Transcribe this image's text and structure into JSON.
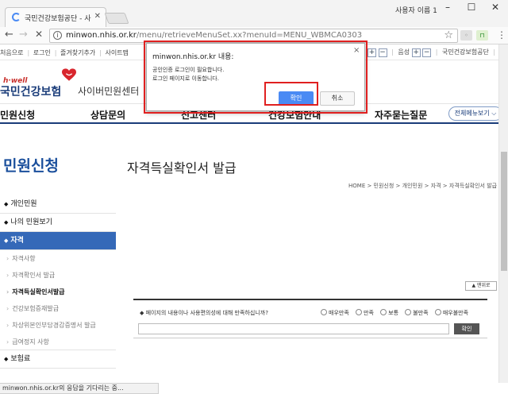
{
  "browser": {
    "tab_title": "국민건강보험공단 - 사이",
    "profile": "사용자 이름 1",
    "url_host": "minwon.nhis.or.kr",
    "url_path": "/menu/retrieveMenuSet.xx?menuId=MENU_WBMCA0303",
    "status_text": "minwon.nhis.or.kr의 응답을 기다리는 중..."
  },
  "util": {
    "links": [
      "처음으로",
      "로그인",
      "즐겨찾기추가",
      "사이트맵"
    ],
    "plus": "+",
    "minus": "−",
    "sound": "음성",
    "nhis_link": "국민건강보험공단",
    "mobile": "모바"
  },
  "logo": {
    "slogan": "h·well",
    "name": "국민건강보험",
    "center": "사이버민원센터"
  },
  "gnb": {
    "items": [
      "민원신청",
      "상담문의",
      "신고센터",
      "건강보험안내",
      "자주묻는질문"
    ],
    "all_menu": "전체메뉴보기 ⌵"
  },
  "lnb": {
    "title": "민원신청",
    "items": [
      {
        "label": "개인민원",
        "level": 1
      },
      {
        "label": "나의 민원보기",
        "level": 1
      },
      {
        "label": "자격",
        "level": 1
      },
      {
        "label": "자격사항",
        "level": 2
      },
      {
        "label": "자격확인서 발급",
        "level": 2
      },
      {
        "label": "자격득실확인서발급",
        "level": 2
      },
      {
        "label": "건강보험증재발급",
        "level": 2
      },
      {
        "label": "차상위본인부담경감증명서 발급",
        "level": 2
      },
      {
        "label": "급여정지 사항",
        "level": 2
      },
      {
        "label": "보험료",
        "level": 1
      }
    ]
  },
  "main": {
    "title": "자격득실확인서 발급",
    "breadcrumb": "HOME > 민원신청 > 개인민원 > 자격 > 자격득실확인서 발급",
    "top_button": "▲ 맨위로"
  },
  "survey": {
    "question": "◆ 페이지의 내용이나 사용편의성에 대해 만족하십니까?",
    "options": [
      "매우만족",
      "만족",
      "보통",
      "불만족",
      "매우불만족"
    ],
    "submit": "확인"
  },
  "dialog": {
    "title": "minwon.nhis.or.kr 내용:",
    "line1": "공인인증 로그인이 필요합니다.",
    "line2": "로그인 페이지로 이동합니다.",
    "ok": "확인",
    "cancel": "취소",
    "close": "×"
  }
}
